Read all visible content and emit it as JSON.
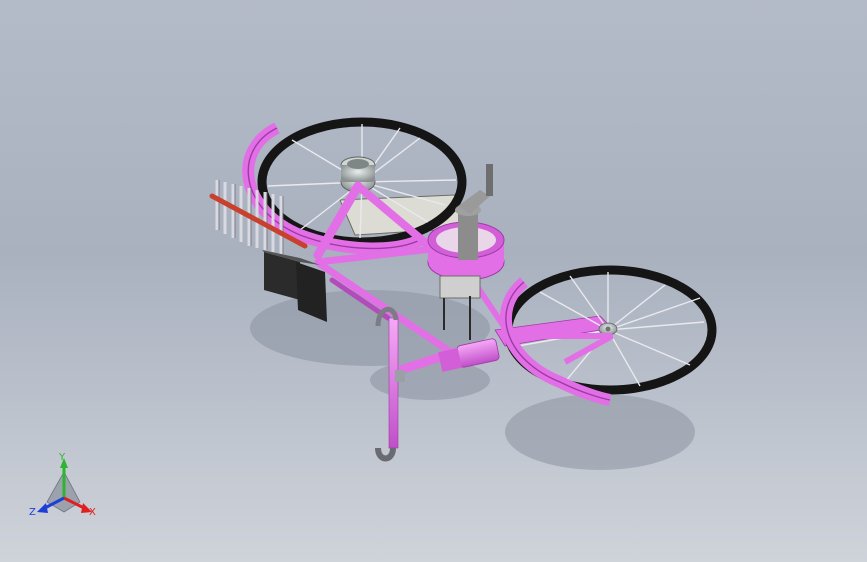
{
  "viewport": {
    "background_top": "#b4bbc8",
    "background_bottom": "#cfd3da",
    "model": "bicycle-assembly"
  },
  "colors": {
    "frame": "#e26fe6",
    "frame_dark": "#9d3aa6",
    "tire": "#151515",
    "spoke": "#e9e9ee",
    "hub": "#bfc7c7",
    "seat_post": "#8c8c8c",
    "brush_handle": "#c8402e",
    "bristle": "#d9d9e2",
    "pad": "#2b2b2b"
  },
  "triad": {
    "y_label": "Y",
    "x_label": "X",
    "z_label": "Z",
    "y_color": "#2db52d",
    "x_color": "#e02020",
    "z_color": "#1e3fd6"
  }
}
